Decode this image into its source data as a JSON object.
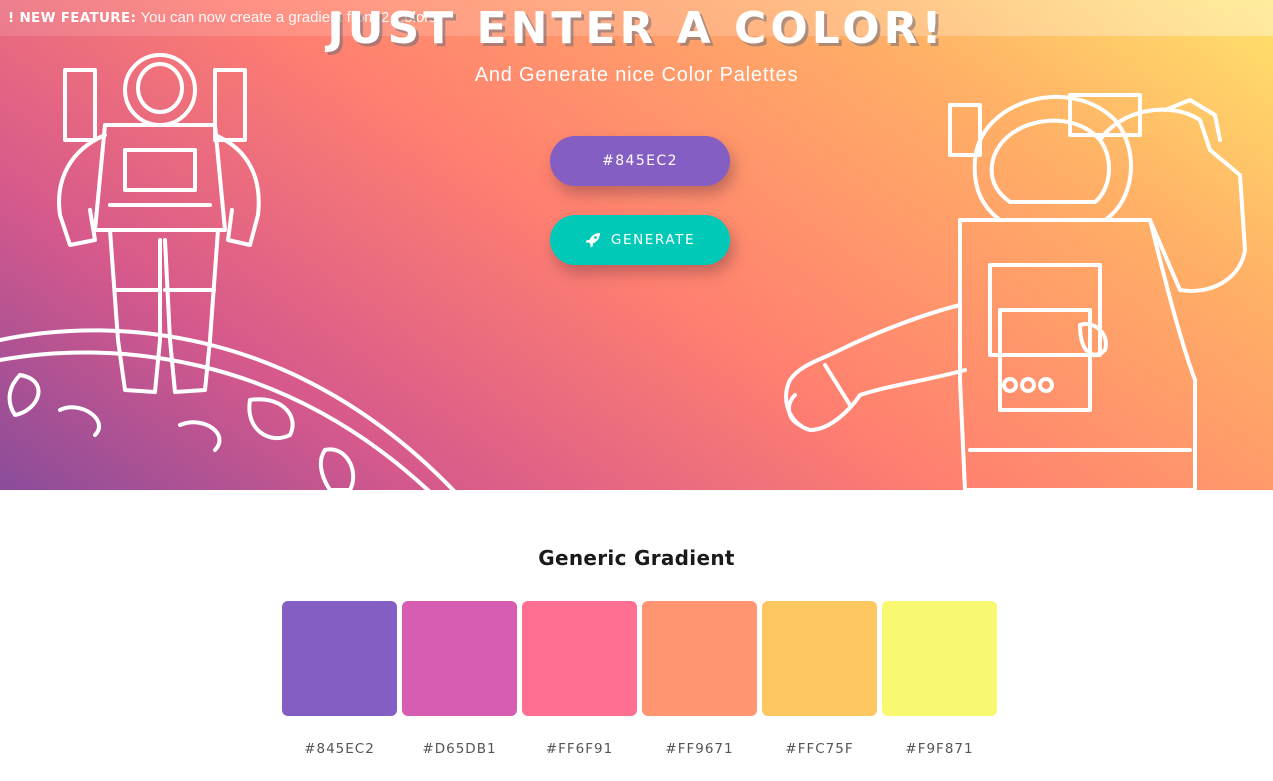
{
  "announcement": {
    "label": "! NEW FEATURE:",
    "message": "You can now create a gradient from 2 Colors!"
  },
  "hero": {
    "title": "JUST ENTER A COLOR!",
    "subtitle": "And Generate nice Color Palettes",
    "input_value": "#845EC2",
    "input_color": "#845EC2",
    "generate_label": "GENERATE",
    "generate_icon": "rocket-icon",
    "generate_color": "#00C9B7"
  },
  "palette": {
    "title": "Generic Gradient",
    "colors": [
      {
        "hex": "#845EC2",
        "label": "#845EC2"
      },
      {
        "hex": "#D65DB1",
        "label": "#D65DB1"
      },
      {
        "hex": "#FF6F91",
        "label": "#FF6F91"
      },
      {
        "hex": "#FF9671",
        "label": "#FF9671"
      },
      {
        "hex": "#FFC75F",
        "label": "#FFC75F"
      },
      {
        "hex": "#F9F871",
        "label": "#F9F871"
      }
    ]
  }
}
